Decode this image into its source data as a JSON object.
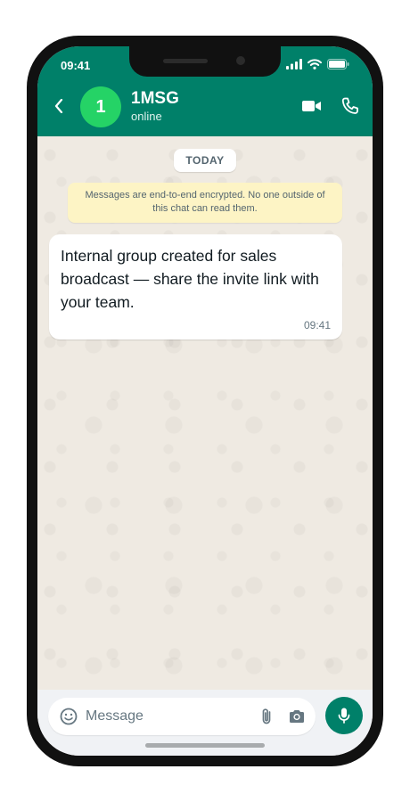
{
  "status_bar": {
    "time": "09:41"
  },
  "header": {
    "avatar_initial": "1",
    "contact_name": "1MSG",
    "contact_status": "online"
  },
  "chat": {
    "date_label": "TODAY",
    "encryption_note": "Messages are end-to-end encrypted. No one outside of this chat can read them.",
    "messages": [
      {
        "text": "Internal group created for sales broadcast — share the invite link with your team.",
        "time": "09:41"
      }
    ]
  },
  "composer": {
    "placeholder": "Message"
  },
  "colors": {
    "header": "#008069",
    "avatar": "#25d366",
    "chat_background": "#efeae2",
    "encryption_note": "#fdf4c5",
    "send_button": "#008069"
  },
  "icons": [
    "back-arrow-icon",
    "video-call-icon",
    "phone-call-icon",
    "emoji-icon",
    "paperclip-icon",
    "camera-icon",
    "microphone-icon",
    "signal-icon",
    "wifi-icon",
    "battery-icon"
  ]
}
